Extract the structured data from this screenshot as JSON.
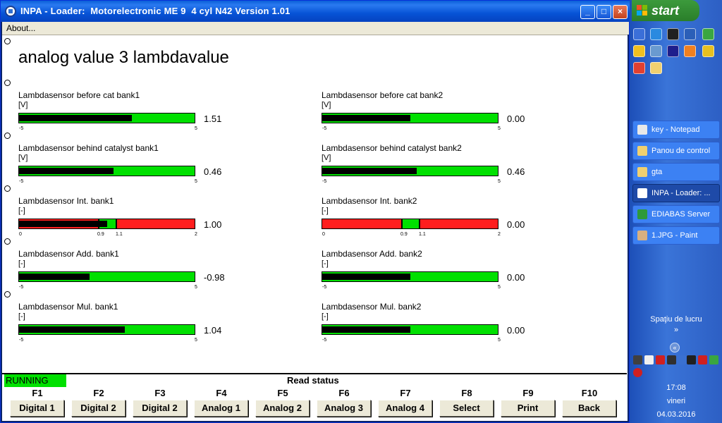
{
  "window": {
    "title": "INPA - Loader:  Motorelectronic ME 9  4 cyl N42 Version 1.01",
    "minimize": "_",
    "maximize": "□",
    "close": "×"
  },
  "menu": {
    "about": "About..."
  },
  "page": {
    "title": "analog value 3 lambdavalue"
  },
  "sensors": [
    {
      "name": "Lambdasensor before cat bank1",
      "unit": "[V]",
      "value": "1.51",
      "fill": 0.644,
      "scale_min": "-5",
      "scale_max": "5",
      "type": "standard"
    },
    {
      "name": "Lambdasensor before cat bank2",
      "unit": "[V]",
      "value": "0.00",
      "fill": 0.5,
      "scale_min": "-5",
      "scale_max": "5",
      "type": "standard"
    },
    {
      "name": "Lambdasensor behind catalyst bank1",
      "unit": "[V]",
      "value": "0.46",
      "fill": 0.54,
      "scale_min": "-5",
      "scale_max": "5",
      "type": "standard"
    },
    {
      "name": "Lambdasensor behind catalyst bank2",
      "unit": "[V]",
      "value": "0.46",
      "fill": 0.54,
      "scale_min": "-5",
      "scale_max": "5",
      "type": "standard"
    },
    {
      "name": "Lambdasensor Int. bank1",
      "unit": "[-]",
      "value": "1.00",
      "fill": 0.5,
      "scale_min": "0",
      "scale_mid1": "0.9",
      "scale_mid2": "1.1",
      "scale_max": "2",
      "type": "window"
    },
    {
      "name": "Lambdasensor Int. bank2",
      "unit": "[-]",
      "value": "0.00",
      "fill": 0.0,
      "scale_min": "0",
      "scale_mid1": "0.9",
      "scale_mid2": "1.1",
      "scale_max": "2",
      "type": "window"
    },
    {
      "name": "Lambdasensor Add. bank1",
      "unit": "[-]",
      "value": "-0.98",
      "fill": 0.402,
      "scale_min": "-5",
      "scale_max": "5",
      "type": "standard"
    },
    {
      "name": "Lambdasensor Add. bank2",
      "unit": "[-]",
      "value": "0.00",
      "fill": 0.5,
      "scale_min": "-5",
      "scale_max": "5",
      "type": "standard"
    },
    {
      "name": "Lambdasensor Mul. bank1",
      "unit": "[-]",
      "value": "1.04",
      "fill": 0.604,
      "scale_min": "-5",
      "scale_max": "5",
      "type": "standard"
    },
    {
      "name": "Lambdasensor Mul. bank2",
      "unit": "[-]",
      "value": "0.00",
      "fill": 0.5,
      "scale_min": "-5",
      "scale_max": "5",
      "type": "standard"
    }
  ],
  "status": {
    "running": "RUNNING",
    "label": "Read status"
  },
  "fkeys": [
    {
      "key": "F1",
      "label": "Digital 1"
    },
    {
      "key": "F2",
      "label": "Digital 2"
    },
    {
      "key": "F3",
      "label": "Digital 2"
    },
    {
      "key": "F4",
      "label": "Analog 1"
    },
    {
      "key": "F5",
      "label": "Analog 2"
    },
    {
      "key": "F6",
      "label": "Analog 3"
    },
    {
      "key": "F7",
      "label": "Analog 4"
    },
    {
      "key": "F8",
      "label": "Select"
    },
    {
      "key": "F9",
      "label": "Print"
    },
    {
      "key": "F10",
      "label": "Back"
    }
  ],
  "taskbar": {
    "start_label": "start",
    "tasks": [
      {
        "label": "key - Notepad",
        "icon": "notepad-icon",
        "color": "#e8e8e8"
      },
      {
        "label": "Panou de control",
        "icon": "folder-icon",
        "color": "#f0d070"
      },
      {
        "label": "gta",
        "icon": "folder-icon",
        "color": "#f0d070"
      },
      {
        "label": "INPA - Loader: ...",
        "icon": "bmw-icon",
        "color": "#ffffff"
      },
      {
        "label": "EDIABAS Server",
        "icon": "ediabas-icon",
        "color": "#2e9a3a"
      },
      {
        "label": "1.JPG - Paint",
        "icon": "paint-icon",
        "color": "#d8b080"
      }
    ],
    "workspace": "Spaţiu de lucru",
    "workspace_chevron": "»",
    "tray_collapse": "«",
    "clock": {
      "time": "17:08",
      "day": "vineri",
      "date": "04.03.2016"
    }
  },
  "colors": {
    "gauge_green": "#00e000",
    "gauge_red": "#ff1e1e",
    "gauge_fill": "#000000",
    "running_green": "#00e000"
  }
}
